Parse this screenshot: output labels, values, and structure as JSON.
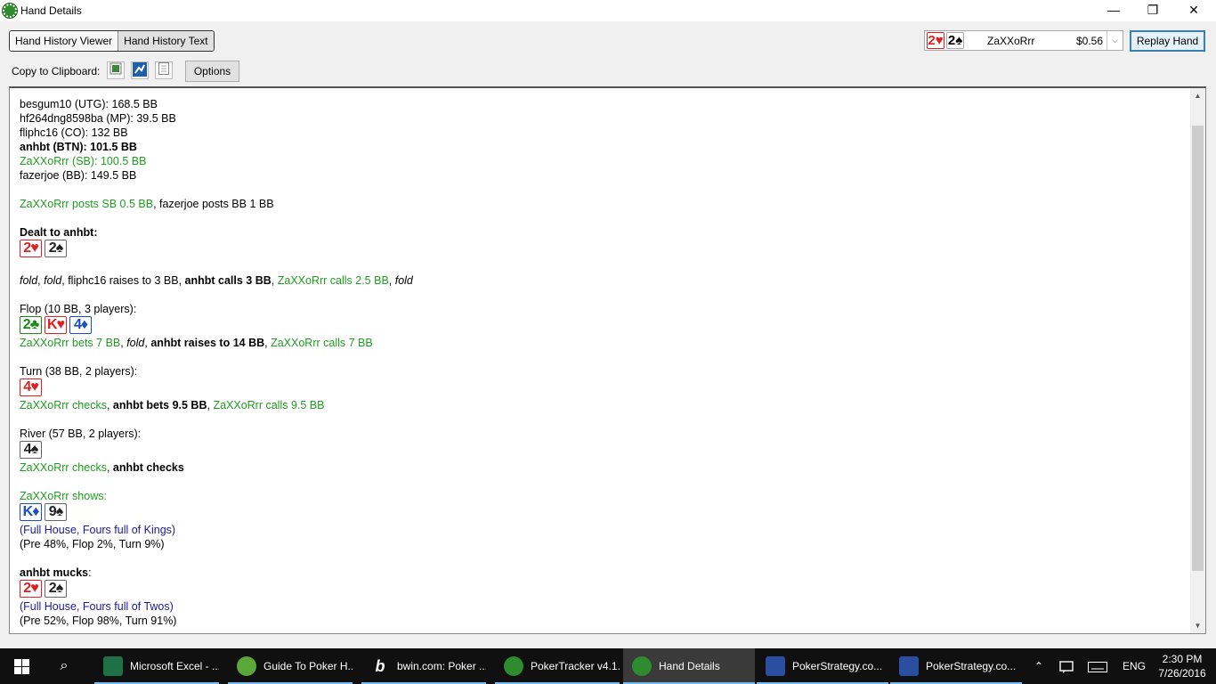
{
  "window": {
    "title": "Hand Details",
    "minimize": "—",
    "maximize": "❐",
    "close": "✕"
  },
  "tabs": [
    {
      "label": "Hand History Viewer"
    },
    {
      "label": "Hand History Text"
    }
  ],
  "player_select": {
    "cards": [
      {
        "rank": "2",
        "suit": "♥"
      },
      {
        "rank": "2",
        "suit": "♠"
      }
    ],
    "name": "ZaXXoRrr",
    "amount": "$0.56",
    "arrow": "⌵"
  },
  "replay_button": "Replay Hand",
  "clipboard": {
    "label": "Copy to Clipboard:",
    "options_button": "Options"
  },
  "hand": {
    "seats": [
      "besgum10 (UTG): 168.5 BB",
      "hf264dng8598ba (MP): 39.5 BB",
      "fliphc16 (CO): 132 BB",
      "anhbt (BTN): 101.5 BB",
      "ZaXXoRrr (SB): 100.5 BB",
      "fazerjoe (BB): 149.5 BB"
    ],
    "blinds": {
      "sb": "ZaXXoRrr posts SB 0.5 BB",
      "sep": ", ",
      "bb": "fazerjoe posts BB 1 BB"
    },
    "dealt_label": "Dealt to anhbt:",
    "dealt_cards": [
      {
        "rank": "2",
        "suit": "♥"
      },
      {
        "rank": "2",
        "suit": "♠"
      }
    ],
    "preflop": {
      "a1": "fold",
      "s1": ", ",
      "a2": "fold",
      "s2": ", fliphc16 raises to 3 BB, ",
      "a3": "anhbt calls 3 BB",
      "s3": ", ",
      "a4": "ZaXXoRrr calls 2.5 BB",
      "s4": ", ",
      "a5": "fold"
    },
    "flop": {
      "header": "Flop (10 BB, 3 players):",
      "cards": [
        {
          "rank": "2",
          "suit": "♣"
        },
        {
          "rank": "K",
          "suit": "♥"
        },
        {
          "rank": "4",
          "suit": "♦"
        }
      ],
      "a1": "ZaXXoRrr bets 7 BB",
      "s1": ", ",
      "a2": "fold",
      "s2": ", ",
      "a3": "anhbt raises to 14 BB",
      "s3": ", ",
      "a4": "ZaXXoRrr calls 7 BB"
    },
    "turn": {
      "header": "Turn (38 BB, 2 players):",
      "cards": [
        {
          "rank": "4",
          "suit": "♥"
        }
      ],
      "a1": "ZaXXoRrr checks",
      "s1": ", ",
      "a2": "anhbt bets 9.5 BB",
      "s2": ", ",
      "a3": "ZaXXoRrr calls 9.5 BB"
    },
    "river": {
      "header": "River (57 BB, 2 players):",
      "cards": [
        {
          "rank": "4",
          "suit": "♠"
        }
      ],
      "a1": "ZaXXoRrr checks",
      "s1": ", ",
      "a2": "anhbt checks"
    },
    "showdown1": {
      "label": "ZaXXoRrr shows:",
      "cards": [
        {
          "rank": "K",
          "suit": "♦"
        },
        {
          "rank": "9",
          "suit": "♠"
        }
      ],
      "hand": "(Full House, Fours full of Kings)",
      "equity": "(Pre 48%, Flop 2%, Turn 9%)"
    },
    "showdown2": {
      "label": "anhbt mucks",
      "colon": ":",
      "cards": [
        {
          "rank": "2",
          "suit": "♥"
        },
        {
          "rank": "2",
          "suit": "♠"
        }
      ],
      "hand": "(Full House, Fours full of Twos)",
      "equity": "(Pre 52%, Flop 98%, Turn 91%)"
    }
  },
  "taskbar": {
    "items": [
      {
        "label": "Microsoft Excel - ...",
        "color": "#1e7145"
      },
      {
        "label": "Guide To Poker H...",
        "color": "#5aa83a"
      },
      {
        "label": "bwin.com: Poker ...",
        "color": "#101010"
      },
      {
        "label": "PokerTracker v4.1...",
        "color": "#2e8b2e"
      },
      {
        "label": "Hand Details",
        "color": "#2e8b2e"
      },
      {
        "label": "PokerStrategy.co...",
        "color": "#2a4fa0"
      },
      {
        "label": "PokerStrategy.co...",
        "color": "#2a4fa0"
      }
    ],
    "tray_lang": "ENG",
    "time": "2:30 PM",
    "date": "7/26/2016"
  }
}
